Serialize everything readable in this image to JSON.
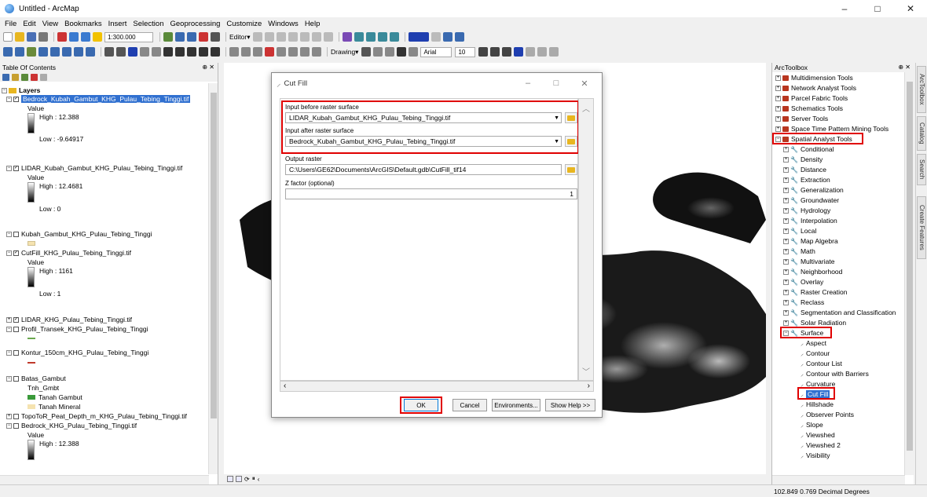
{
  "window": {
    "title": "Untitled - ArcMap",
    "controls": [
      "–",
      "□",
      "✕"
    ]
  },
  "menu": [
    "File",
    "Edit",
    "View",
    "Bookmarks",
    "Insert",
    "Selection",
    "Geoprocessing",
    "Customize",
    "Windows",
    "Help"
  ],
  "toolbar": {
    "scale": "1:300.000",
    "editor": "Editor▾",
    "drawing": "Drawing▾",
    "font": "Arial",
    "font_size": "10"
  },
  "toc": {
    "title": "Table Of Contents",
    "root": "Layers",
    "items": [
      {
        "name": "Bedrock_Kubah_Gambut_KHG_Pulau_Tebing_Tinggi.tif",
        "value_label": "Value",
        "high": "High : 12.388",
        "low": "Low : -9.64917"
      },
      {
        "name": "LIDAR_Kubah_Gambut_KHG_Pulau_Tebing_Tinggi.tif",
        "value_label": "Value",
        "high": "High : 12.4681",
        "low": "Low : 0"
      },
      {
        "name": "Kubah_Gambut_KHG_Pulau_Tebing_Tinggi"
      },
      {
        "name": "CutFill_KHG_Pulau_Tebing_Tinggi.tif",
        "value_label": "Value",
        "high": "High : 1161",
        "low": "Low : 1"
      },
      {
        "name": "LIDAR_KHG_Pulau_Tebing_Tinggi.tif"
      },
      {
        "name": "Profil_Transek_KHG_Pulau_Tebing_Tinggi"
      },
      {
        "name": "Kontur_150cm_KHG_Pulau_Tebing_Tinggi"
      },
      {
        "name": "Batas_Gambut",
        "field": "Tnh_Gmbt",
        "legend": [
          "Tanah Gambut",
          "Tanah Mineral"
        ]
      },
      {
        "name": "TopoToR_Peat_Depth_m_KHG_Pulau_Tebing_Tinggi.tif"
      },
      {
        "name": "Bedrock_KHG_Pulau_Tebing_Tinggi.tif",
        "value_label": "Value",
        "high": "High : 12.388"
      }
    ]
  },
  "dialog": {
    "title": "Cut Fill",
    "input_before_label": "Input before raster surface",
    "input_before_value": "LIDAR_Kubah_Gambut_KHG_Pulau_Tebing_Tinggi.tif",
    "input_after_label": "Input after raster surface",
    "input_after_value": "Bedrock_Kubah_Gambut_KHG_Pulau_Tebing_Tinggi.tif",
    "output_label": "Output raster",
    "output_value": "C:\\Users\\GE62\\Documents\\ArcGIS\\Default.gdb\\CutFill_tif14",
    "zfactor_label": "Z factor (optional)",
    "zfactor_value": "1",
    "ok": "OK",
    "cancel": "Cancel",
    "environments": "Environments...",
    "show_help": "Show Help >>"
  },
  "arctoolbox": {
    "title": "ArcToolbox",
    "toolboxes": [
      "Multidimension Tools",
      "Network Analyst Tools",
      "Parcel Fabric Tools",
      "Schematics Tools",
      "Server Tools",
      "Space Time Pattern Mining Tools",
      "Spatial Analyst Tools"
    ],
    "spatial_analyst_sets": [
      "Conditional",
      "Density",
      "Distance",
      "Extraction",
      "Generalization",
      "Groundwater",
      "Hydrology",
      "Interpolation",
      "Local",
      "Map Algebra",
      "Math",
      "Multivariate",
      "Neighborhood",
      "Overlay",
      "Raster Creation",
      "Reclass",
      "Segmentation and Classification",
      "Solar Radiation",
      "Surface"
    ],
    "surface_tools": [
      "Aspect",
      "Contour",
      "Contour List",
      "Contour with Barriers",
      "Curvature",
      "Cut Fill",
      "Hillshade",
      "Observer Points",
      "Slope",
      "Viewshed",
      "Viewshed 2",
      "Visibility"
    ]
  },
  "side_tabs": [
    "ArcToolbox",
    "Catalog",
    "Search",
    "Create Features"
  ],
  "status": {
    "coordinates": "102.849  0.769 Decimal Degrees"
  },
  "colors": {
    "highlight": "#e00000",
    "selection": "#3070d0",
    "toolbox_icon": "#b8361f",
    "tanah_gambut": "#3a9a3a",
    "tanah_mineral": "#f5e3b0"
  }
}
